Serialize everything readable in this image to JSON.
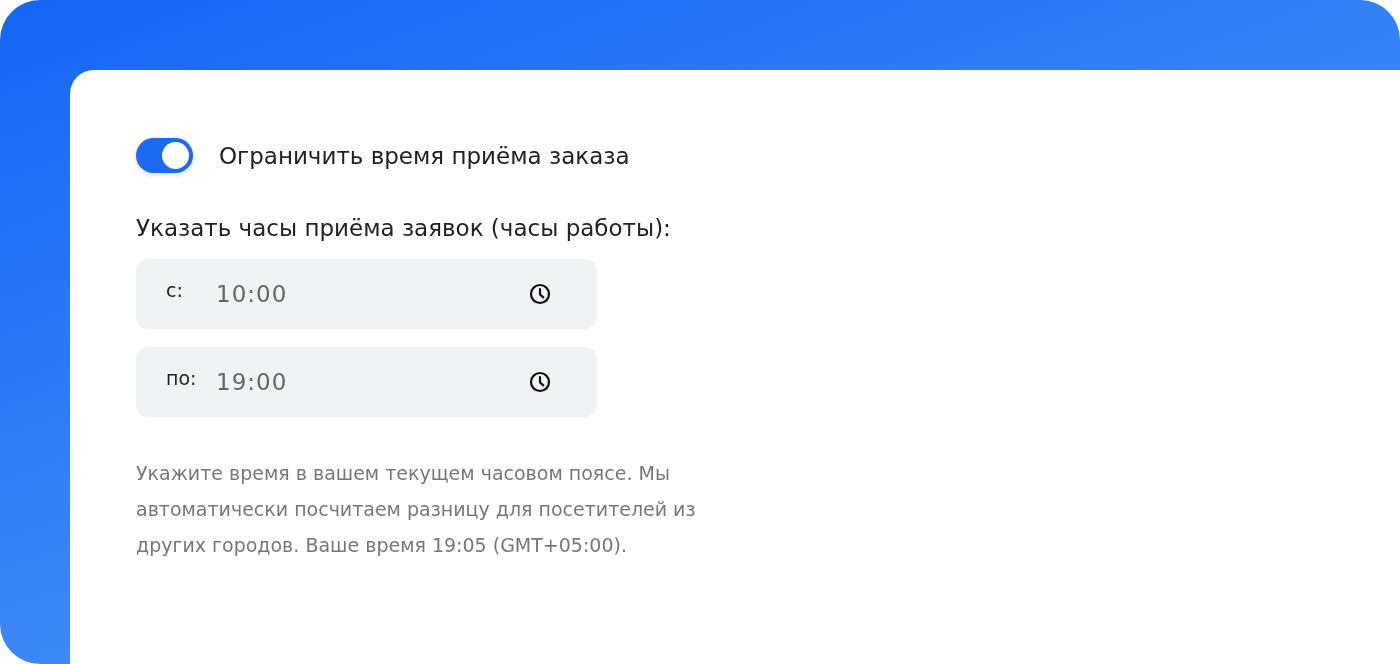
{
  "toggle": {
    "label": "Ограничить время приёма заказа",
    "on": true
  },
  "heading": "Указать часы приёма заявок (часы работы):",
  "fields": [
    {
      "label": "с:",
      "value": "10:00"
    },
    {
      "label": "по:",
      "value": "19:00"
    }
  ],
  "hint": "Укажите время в вашем текущем часовом поясе. Мы автоматически посчитаем разницу для посетителей из других городов. Ваше время 19:05 (GMT+05:00)."
}
